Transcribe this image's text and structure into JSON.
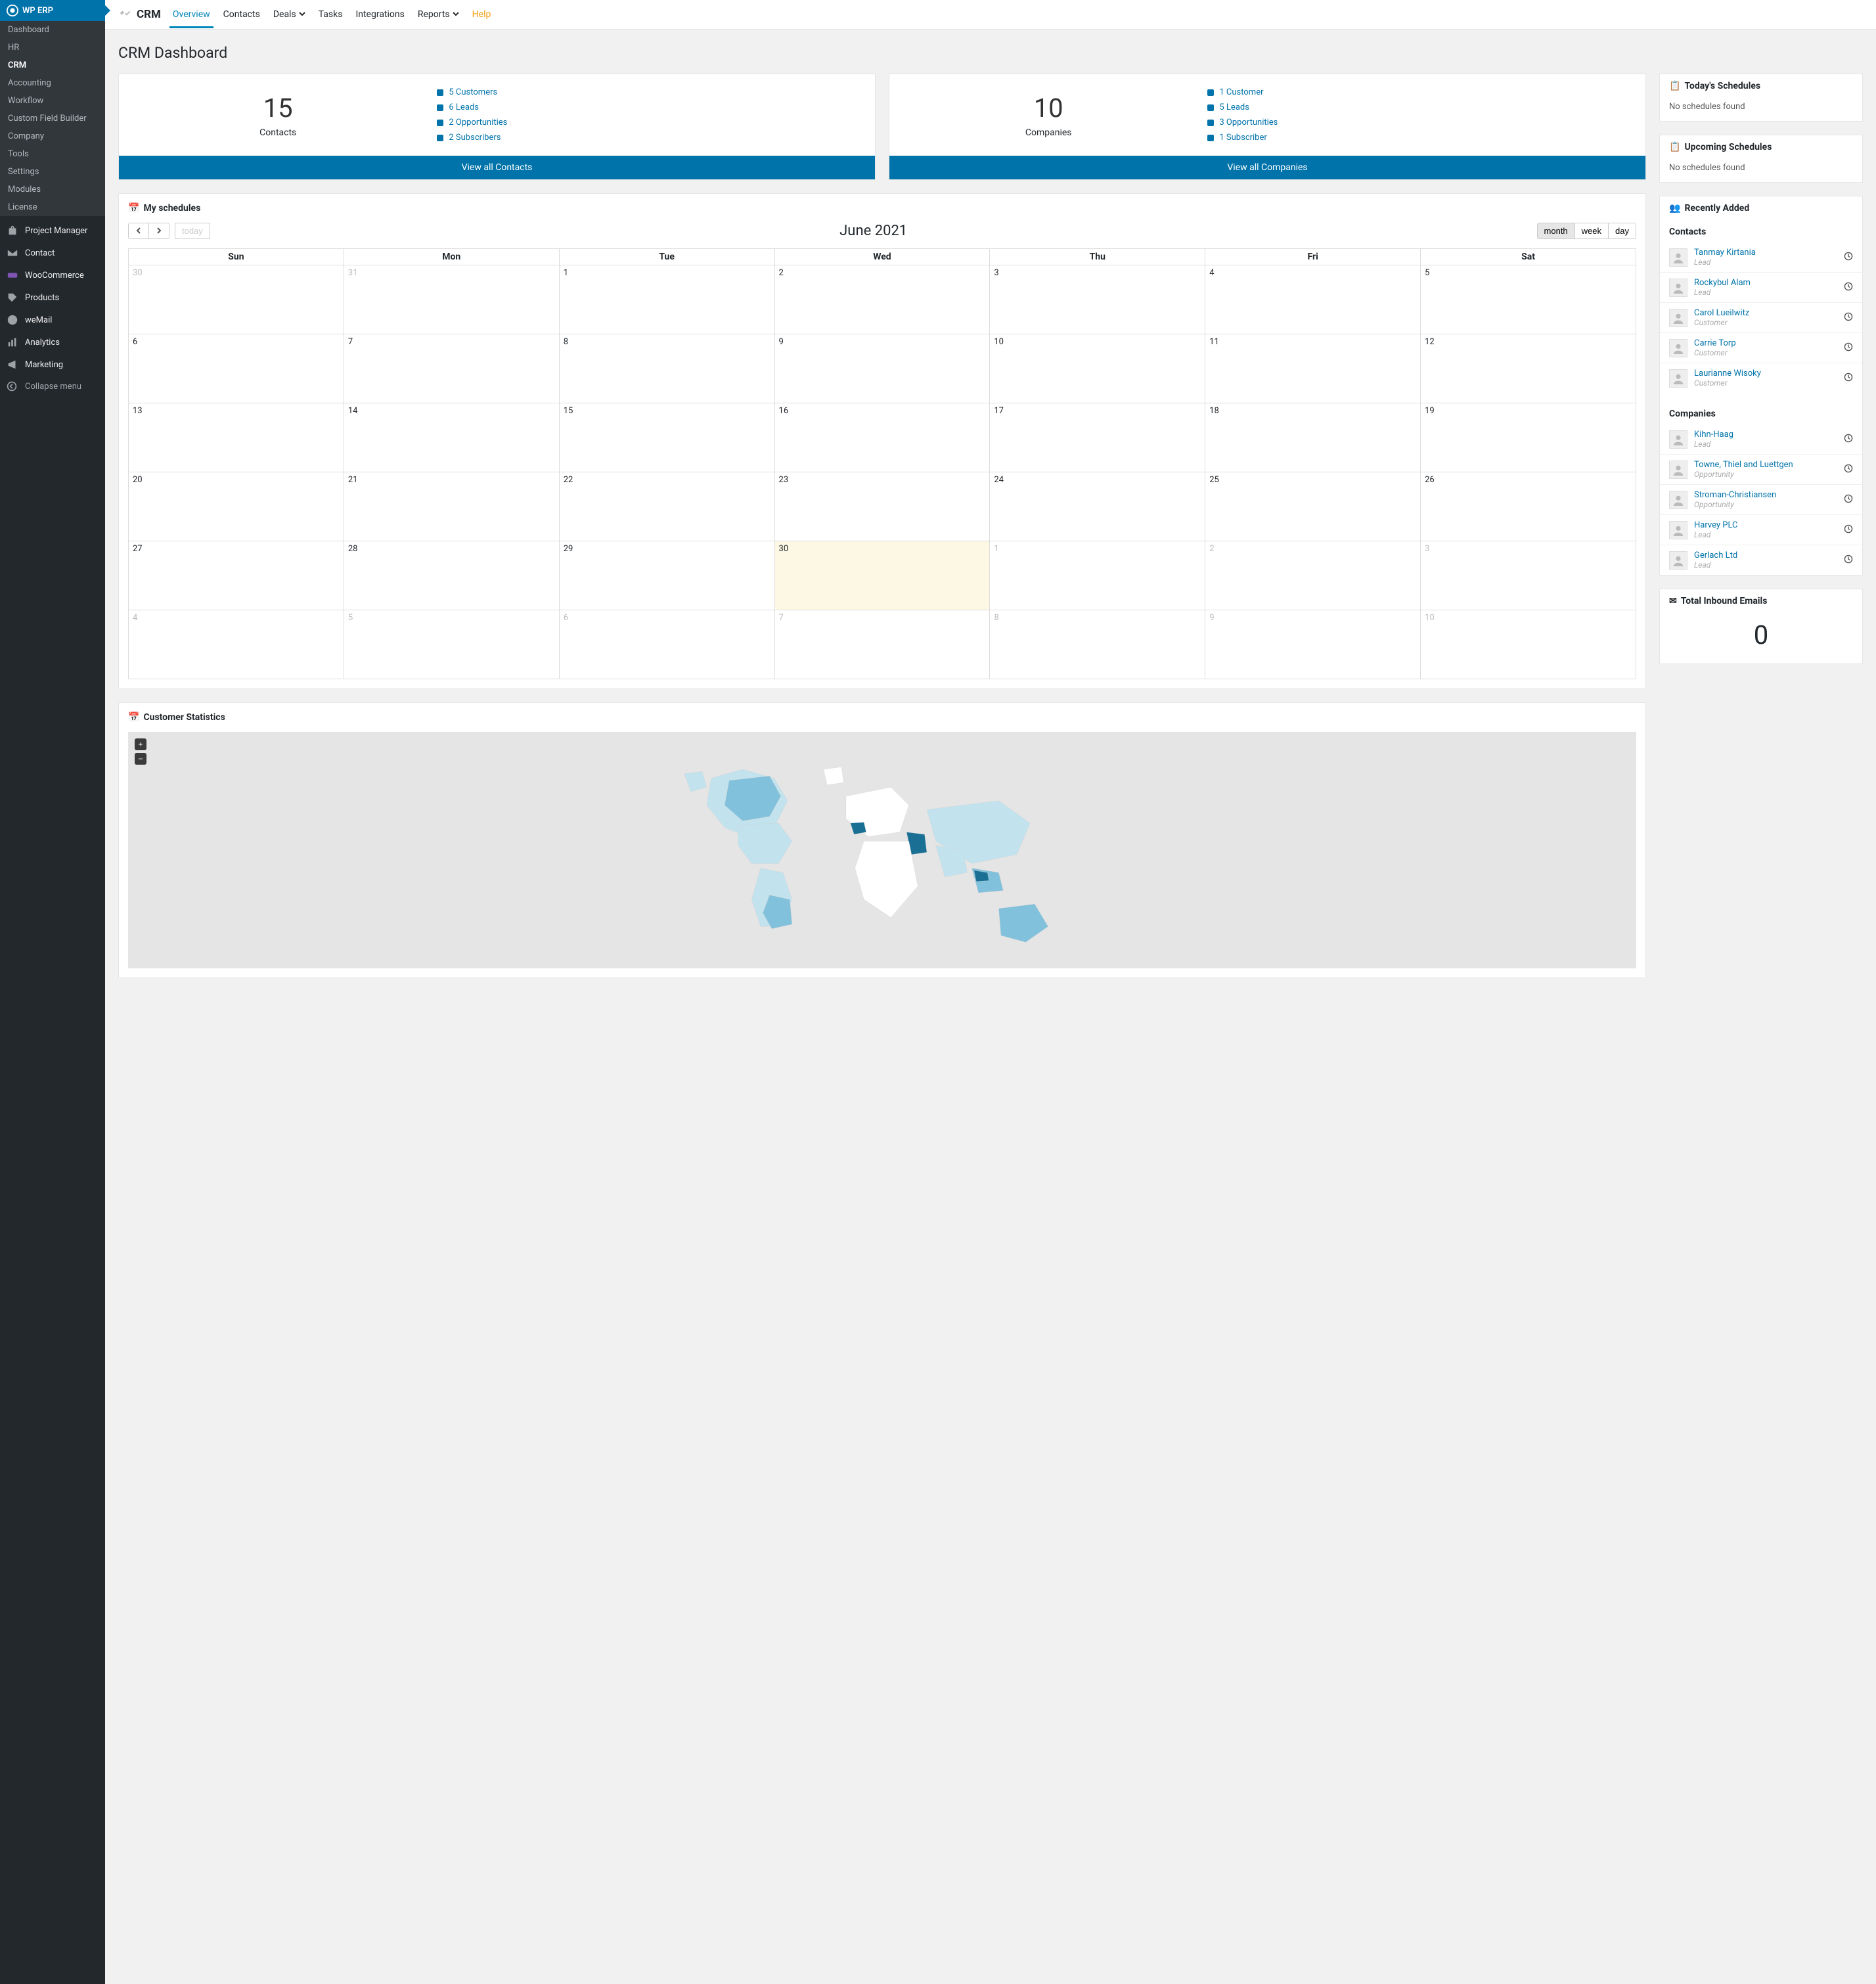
{
  "sidebar": {
    "brand": "WP ERP",
    "sub": [
      "Dashboard",
      "HR",
      "CRM",
      "Accounting",
      "Workflow",
      "Custom Field Builder",
      "Company",
      "Tools",
      "Settings",
      "Modules",
      "License"
    ],
    "active_sub": "CRM",
    "items": [
      {
        "icon": "project",
        "label": "Project Manager"
      },
      {
        "icon": "contact",
        "label": "Contact"
      },
      {
        "icon": "woo",
        "label": "WooCommerce"
      },
      {
        "icon": "products",
        "label": "Products"
      },
      {
        "icon": "wemail",
        "label": "weMail"
      },
      {
        "icon": "analytics",
        "label": "Analytics"
      },
      {
        "icon": "marketing",
        "label": "Marketing"
      }
    ],
    "collapse": "Collapse menu"
  },
  "topbar": {
    "brand": "CRM",
    "nav": [
      "Overview",
      "Contacts",
      "Deals",
      "Tasks",
      "Integrations",
      "Reports",
      "Help"
    ],
    "active": "Overview",
    "dropdowns": [
      "Deals",
      "Reports"
    ],
    "help": "Help"
  },
  "page_title": "CRM Dashboard",
  "stats": [
    {
      "count": "15",
      "label": "Contacts",
      "items": [
        "5 Customers",
        "6 Leads",
        "2 Opportunities",
        "2 Subscribers"
      ],
      "button": "View all Contacts"
    },
    {
      "count": "10",
      "label": "Companies",
      "items": [
        "1 Customer",
        "5 Leads",
        "3 Opportunities",
        "1 Subscriber"
      ],
      "button": "View all Companies"
    }
  ],
  "schedules": {
    "today_title": "Today's Schedules",
    "today_body": "No schedules found",
    "upcoming_title": "Upcoming Schedules",
    "upcoming_body": "No schedules found"
  },
  "calendar": {
    "title": "My schedules",
    "month_label": "June 2021",
    "today_btn": "today",
    "views": {
      "month": "month",
      "week": "week",
      "day": "day"
    },
    "days": [
      "Sun",
      "Mon",
      "Tue",
      "Wed",
      "Thu",
      "Fri",
      "Sat"
    ],
    "weeks": [
      [
        {
          "d": "30",
          "o": true
        },
        {
          "d": "31",
          "o": true
        },
        {
          "d": "1"
        },
        {
          "d": "2"
        },
        {
          "d": "3"
        },
        {
          "d": "4"
        },
        {
          "d": "5"
        }
      ],
      [
        {
          "d": "6"
        },
        {
          "d": "7"
        },
        {
          "d": "8"
        },
        {
          "d": "9"
        },
        {
          "d": "10"
        },
        {
          "d": "11"
        },
        {
          "d": "12"
        }
      ],
      [
        {
          "d": "13"
        },
        {
          "d": "14"
        },
        {
          "d": "15"
        },
        {
          "d": "16"
        },
        {
          "d": "17"
        },
        {
          "d": "18"
        },
        {
          "d": "19"
        }
      ],
      [
        {
          "d": "20"
        },
        {
          "d": "21"
        },
        {
          "d": "22"
        },
        {
          "d": "23"
        },
        {
          "d": "24"
        },
        {
          "d": "25"
        },
        {
          "d": "26"
        }
      ],
      [
        {
          "d": "27"
        },
        {
          "d": "28"
        },
        {
          "d": "29"
        },
        {
          "d": "30",
          "t": true
        },
        {
          "d": "1",
          "o": true
        },
        {
          "d": "2",
          "o": true
        },
        {
          "d": "3",
          "o": true
        }
      ],
      [
        {
          "d": "4",
          "o": true
        },
        {
          "d": "5",
          "o": true
        },
        {
          "d": "6",
          "o": true
        },
        {
          "d": "7",
          "o": true
        },
        {
          "d": "8",
          "o": true
        },
        {
          "d": "9",
          "o": true
        },
        {
          "d": "10",
          "o": true
        }
      ]
    ]
  },
  "map_title": "Customer Statistics",
  "recent": {
    "title": "Recently Added",
    "contacts_label": "Contacts",
    "companies_label": "Companies",
    "contacts": [
      {
        "name": "Tanmay Kirtania",
        "role": "Lead"
      },
      {
        "name": "Rockybul Alam",
        "role": "Lead"
      },
      {
        "name": "Carol Lueilwitz",
        "role": "Customer"
      },
      {
        "name": "Carrie Torp",
        "role": "Customer"
      },
      {
        "name": "Laurianne Wisoky",
        "role": "Customer"
      }
    ],
    "companies": [
      {
        "name": "Kihn-Haag",
        "role": "Lead"
      },
      {
        "name": "Towne, Thiel and Luettgen",
        "role": "Opportunity"
      },
      {
        "name": "Stroman-Christiansen",
        "role": "Opportunity"
      },
      {
        "name": "Harvey PLC",
        "role": "Lead"
      },
      {
        "name": "Gerlach Ltd",
        "role": "Lead"
      }
    ]
  },
  "inbound": {
    "title": "Total Inbound Emails",
    "count": "0"
  }
}
